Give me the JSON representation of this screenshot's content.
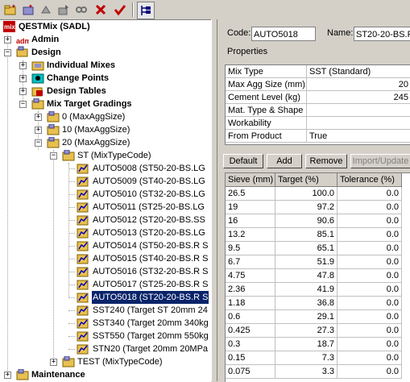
{
  "toolbar": {
    "icons": [
      "new-folder-icon",
      "new-item-icon",
      "copy-icon",
      "move-icon",
      "link-icon",
      "delete-icon",
      "check-icon",
      "tree-view-icon"
    ]
  },
  "tree": {
    "root": "QESTMix (SADL)",
    "admin": "Admin",
    "design": "Design",
    "individual_mixes": "Individual Mixes",
    "change_points": "Change Points",
    "design_tables": "Design Tables",
    "mix_target_gradings": "Mix Target Gradings",
    "groups": [
      "0 (MaxAggSize)",
      "10 (MaxAggSize)",
      "20 (MaxAggSize)"
    ],
    "st": "ST (MixTypeCode)",
    "items": [
      "AUTO5008 (ST50-20-BS.LG",
      "AUTO5009 (ST40-20-BS.LG",
      "AUTO5010 (ST32-20-BS.LG",
      "AUTO5011 (ST25-20-BS.LG",
      "AUTO5012 (ST20-20-BS.SS",
      "AUTO5013 (ST20-20-BS.LG",
      "AUTO5014 (ST50-20-BS.R S",
      "AUTO5015 (ST40-20-BS.R S",
      "AUTO5016 (ST32-20-BS.R S",
      "AUTO5017 (ST25-20-BS.R S",
      "AUTO5018 (ST20-20-BS.R S",
      "SST240 (Target ST 20mm 24",
      "SST340 (Target 20mm 340kg",
      "SST550 (Target 20mm 550kg",
      "STN20 (Target 20mm 20MPa"
    ],
    "selected_index": 10,
    "test": "TEST (MixTypeCode)",
    "maintenance": "Maintenance"
  },
  "detail": {
    "code_label": "Code:",
    "code_value": "AUTO5018",
    "name_label": "Name:",
    "name_value": "ST20-20-BS.R",
    "properties_label": "Properties",
    "properties": [
      {
        "key": "Mix Type",
        "value": "SST (Standard)",
        "align": "left"
      },
      {
        "key": "Max Agg Size (mm)",
        "value": "20",
        "align": "right"
      },
      {
        "key": "Cement Level (kg)",
        "value": "245",
        "align": "right"
      },
      {
        "key": "Mat. Type & Shape",
        "value": "",
        "align": "left"
      },
      {
        "key": "Workability",
        "value": "",
        "align": "left"
      },
      {
        "key": "From Product",
        "value": "True",
        "align": "left"
      }
    ],
    "buttons": {
      "default": "Default",
      "add": "Add",
      "remove": "Remove",
      "import": "Import/Update"
    },
    "grading_headers": [
      "Sieve (mm)",
      "Target (%)",
      "Tolerance (%)"
    ],
    "grading": [
      [
        "26.5",
        "100.0",
        "0.0"
      ],
      [
        "19",
        "97.2",
        "0.0"
      ],
      [
        "16",
        "90.6",
        "0.0"
      ],
      [
        "13.2",
        "85.1",
        "0.0"
      ],
      [
        "9.5",
        "65.1",
        "0.0"
      ],
      [
        "6.7",
        "51.9",
        "0.0"
      ],
      [
        "4.75",
        "47.8",
        "0.0"
      ],
      [
        "2.36",
        "41.9",
        "0.0"
      ],
      [
        "1.18",
        "36.8",
        "0.0"
      ],
      [
        "0.6",
        "29.1",
        "0.0"
      ],
      [
        "0.425",
        "27.3",
        "0.0"
      ],
      [
        "0.3",
        "18.7",
        "0.0"
      ],
      [
        "0.15",
        "7.3",
        "0.0"
      ],
      [
        "0.075",
        "3.3",
        "0.0"
      ]
    ]
  }
}
